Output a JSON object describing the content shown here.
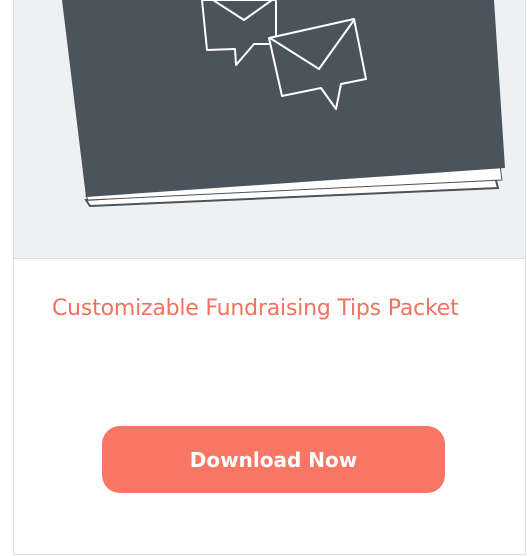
{
  "card": {
    "image": {
      "icons": [
        "booklet-icon",
        "envelope-icon",
        "envelope-icon"
      ]
    },
    "title": "Customizable Fundraising Tips Packet",
    "download_label": "Download Now"
  },
  "colors": {
    "accent": "#f4715f",
    "button": "#f77764",
    "booklet": "#4b545c",
    "hero_bg": "#eef1f2"
  }
}
